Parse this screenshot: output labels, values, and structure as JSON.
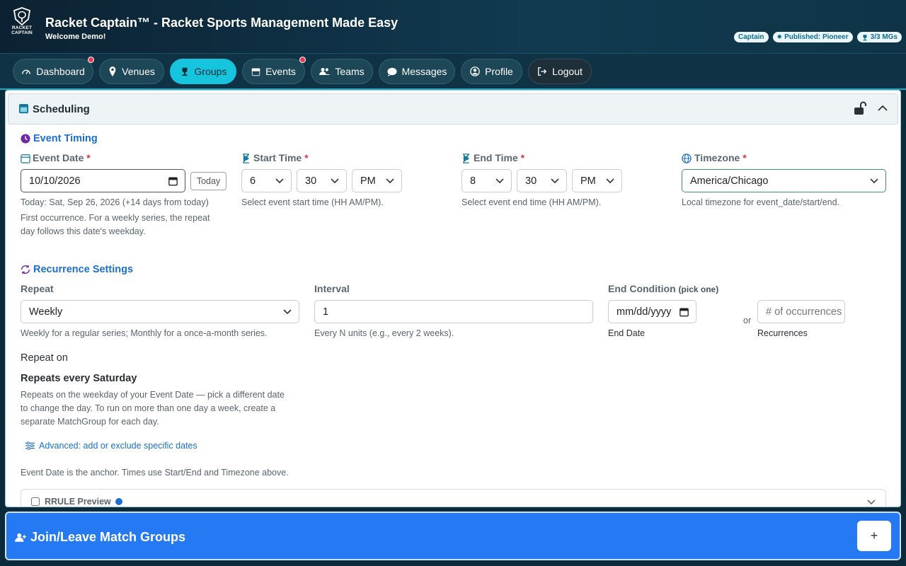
{
  "app": {
    "title": "Racket Captain™ - Racket Sports Management Made Easy",
    "welcome": "Welcome Demo!",
    "logo_text_1": "RACKET",
    "logo_text_2": "CAPTAIN"
  },
  "badges": [
    {
      "label": "Captain"
    },
    {
      "label": "Published: Pioneer"
    },
    {
      "label": "3/3 MGs"
    }
  ],
  "nav": [
    {
      "label": "Dashboard",
      "icon": "gauge-icon"
    },
    {
      "label": "Venues",
      "icon": "map-pin-icon"
    },
    {
      "label": "Groups",
      "icon": "trophy-icon"
    },
    {
      "label": "Events",
      "icon": "calendar-icon"
    },
    {
      "label": "Teams",
      "icon": "users-icon"
    },
    {
      "label": "Messages",
      "icon": "chat-icon"
    },
    {
      "label": "Profile",
      "icon": "user-circle-icon"
    },
    {
      "label": "Logout",
      "icon": "logout-icon"
    }
  ],
  "section": {
    "title": "Scheduling"
  },
  "timing": {
    "heading": "Event Timing",
    "event_date": {
      "label": "Event Date",
      "value": "10/10/2026",
      "today_button": "Today",
      "help_today": "Today: Sat, Sep 26, 2026 (+14 days from today)",
      "help_1": "First occurrence. For a weekly series, the repeat",
      "help_2": "day follows this date's weekday."
    },
    "start_time": {
      "label": "Start Time",
      "hour": "6",
      "minute": "30",
      "ampm": "PM",
      "help": "Select event start time (HH AM/PM)."
    },
    "end_time": {
      "label": "End Time",
      "hour": "8",
      "minute": "30",
      "ampm": "PM",
      "help": "Select event end time (HH AM/PM)."
    },
    "timezone": {
      "label": "Timezone",
      "value": "America/Chicago",
      "help": "Local timezone for event_date/start/end."
    },
    "required_mark": "*"
  },
  "recurrence": {
    "heading": "Recurrence Settings",
    "repeat": {
      "label": "Repeat",
      "value": "Weekly",
      "help": "Weekly for a regular series; Monthly for a once-a-month series."
    },
    "interval": {
      "label": "Interval",
      "value": "1",
      "help": "Every N units (e.g., every 2 weeks)."
    },
    "end_condition": {
      "label": "End Condition",
      "label_small": "(pick one)",
      "date_placeholder": "mm/dd/yyyy",
      "date_caption": "End Date",
      "or_text": "or",
      "count_placeholder": "# of occurrences",
      "count_caption": "Recurrences"
    },
    "repeat_on_label": "Repeat on",
    "repeats_every": "Repeats every Saturday",
    "repeats_help_1": "Repeats on the weekday of your Event Date — pick a different date",
    "repeats_help_2": "to change the day. To run on more than one day a week, create a",
    "repeats_help_3": "separate MatchGroup for each day.",
    "advanced_link": "Advanced: add or exclude specific dates",
    "anchor_note": "Event Date is the anchor. Times use Start/End and Timezone above."
  },
  "rrule": {
    "label": "RRULE Preview"
  },
  "bottom": {
    "title": "Join/Leave Match Groups",
    "plus": "+"
  },
  "colors": {
    "accent": "#17c4dd",
    "header_bg": "#0c2233",
    "primary_blue": "#2579f2",
    "link_blue": "#1b6fd0",
    "required_red": "#d9344a",
    "notification_dot": "#e83a54"
  }
}
